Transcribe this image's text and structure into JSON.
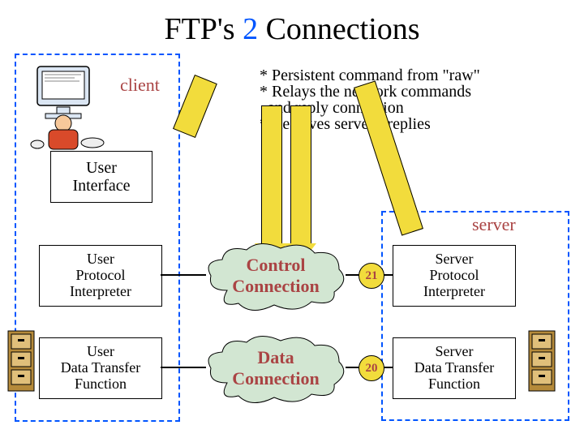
{
  "title_prefix": "FTP's ",
  "title_two": "2",
  "title_suffix": " Connections",
  "labels": {
    "client": "client",
    "server": "server"
  },
  "boxes": {
    "user_interface": "User\nInterface",
    "user_pi": "User\nProtocol\nInterpreter",
    "user_dtf": "User\nData Transfer\nFunction",
    "server_pi": "Server\nProtocol\nInterpreter",
    "server_dtf": "Server\nData Transfer\nFunction"
  },
  "clouds": {
    "control": "Control\nConnection",
    "data": "Data\nConnection"
  },
  "ports": {
    "control": "21",
    "data": "20"
  },
  "bullets": {
    "l1": "* Persistent command from \"raw\"",
    "l2": "* Relays the network commands",
    "l3": "  and reply connection",
    "l4": "* Receives server's replies"
  }
}
